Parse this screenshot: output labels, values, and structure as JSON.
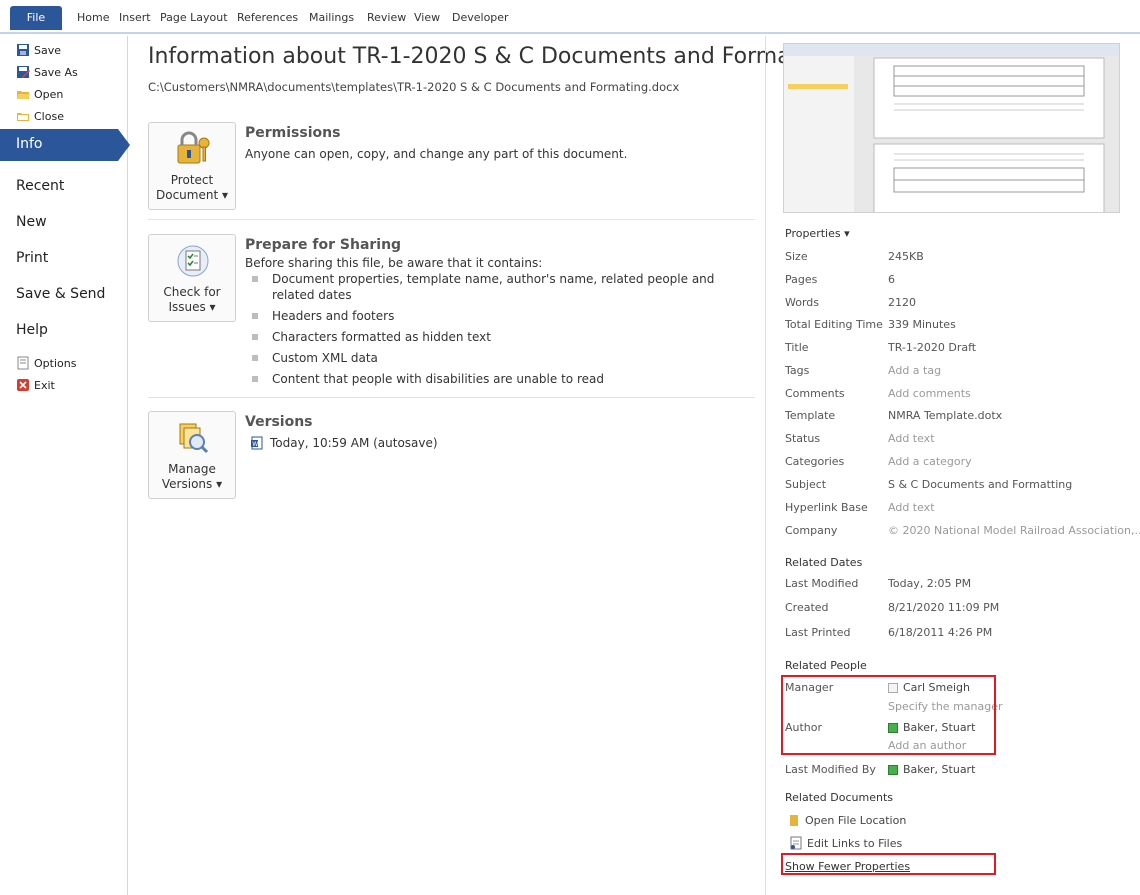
{
  "ribbon": {
    "file_tab": "File",
    "tabs": [
      "Home",
      "Insert",
      "Page Layout",
      "References",
      "Mailings",
      "Review",
      "View",
      "Developer"
    ]
  },
  "nav": {
    "save": "Save",
    "save_as": "Save As",
    "open": "Open",
    "close": "Close",
    "info": "Info",
    "recent": "Recent",
    "new": "New",
    "print": "Print",
    "save_send": "Save & Send",
    "help": "Help",
    "options": "Options",
    "exit": "Exit"
  },
  "document": {
    "title": "Information about TR-1-2020 S & C Documents and Forma...",
    "path": "C:\\Customers\\NMRA\\documents\\templates\\TR-1-2020 S & C Documents and Formating.docx"
  },
  "permissions": {
    "button_line1": "Protect",
    "button_line2": "Document ▾",
    "title": "Permissions",
    "text": "Anyone can open, copy, and change any part of this document."
  },
  "prepare": {
    "button_line1": "Check for",
    "button_line2": "Issues ▾",
    "title": "Prepare for Sharing",
    "text": "Before sharing this file, be aware that it contains:",
    "items": [
      "Document properties, template name, author's name, related people and related dates",
      "Headers and footers",
      "Characters formatted as hidden text",
      "Custom XML data",
      "Content that people with disabilities are unable to read"
    ]
  },
  "versions": {
    "button_line1": "Manage",
    "button_line2": "Versions ▾",
    "title": "Versions",
    "entry": "Today, 10:59 AM (autosave)"
  },
  "properties": {
    "header": "Properties ▾",
    "rows": [
      {
        "key": "Size",
        "value": "245KB"
      },
      {
        "key": "Pages",
        "value": "6"
      },
      {
        "key": "Words",
        "value": "2120"
      },
      {
        "key": "Total Editing Time",
        "value": "339 Minutes"
      },
      {
        "key": "Title",
        "value": "TR-1-2020 Draft"
      },
      {
        "key": "Tags",
        "value": "Add a tag"
      },
      {
        "key": "Comments",
        "value": "Add comments"
      },
      {
        "key": "Template",
        "value": "NMRA Template.dotx"
      },
      {
        "key": "Status",
        "value": "Add text"
      },
      {
        "key": "Categories",
        "value": "Add a category"
      },
      {
        "key": "Subject",
        "value": "S & C Documents and Formatting"
      },
      {
        "key": "Hyperlink Base",
        "value": "Add text"
      },
      {
        "key": "Company",
        "value": "© 2020 National Model Railroad Association,..."
      }
    ]
  },
  "related_dates": {
    "header": "Related Dates",
    "last_modified_key": "Last Modified",
    "last_modified": "Today, 2:05 PM",
    "created_key": "Created",
    "created": "8/21/2020 11:09 PM",
    "last_printed_key": "Last Printed",
    "last_printed": "6/18/2011 4:26 PM"
  },
  "related_people": {
    "header": "Related People",
    "manager_key": "Manager",
    "manager": "Carl Smeigh",
    "manager_hint": "Specify the manager",
    "author_key": "Author",
    "author": "Baker, Stuart",
    "author_hint": "Add an author",
    "last_modified_by_key": "Last Modified By",
    "last_modified_by": "Baker, Stuart"
  },
  "related_documents": {
    "header": "Related Documents",
    "open_location": "Open File Location",
    "edit_links": "Edit Links to Files"
  },
  "show_fewer": "Show Fewer Properties"
}
